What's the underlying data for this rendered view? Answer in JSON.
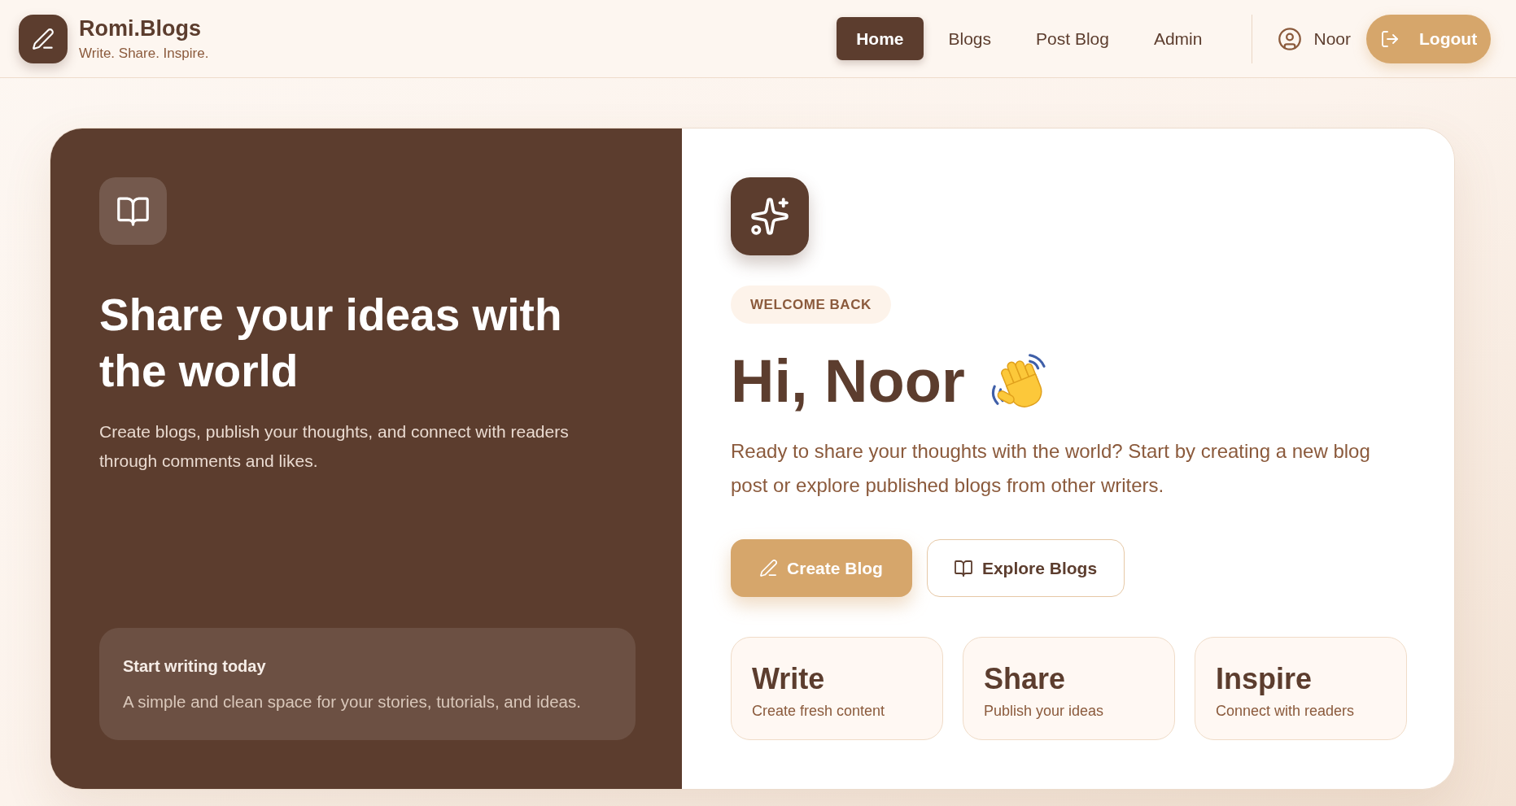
{
  "header": {
    "brand": {
      "name": "Romi.Blogs",
      "tagline": "Write. Share. Inspire."
    },
    "nav": [
      {
        "label": "Home",
        "selected": true
      },
      {
        "label": "Blogs",
        "selected": false
      },
      {
        "label": "Post Blog",
        "selected": false
      },
      {
        "label": "Admin",
        "selected": false
      }
    ],
    "user": {
      "name": "Noor"
    },
    "logout_button": "Logout"
  },
  "hero": {
    "title": "Share your ideas with the world",
    "description": "Create blogs, publish your thoughts, and connect with readers through comments and likes.",
    "callout": {
      "title": "Start writing today",
      "text": "A simple and clean space for your stories, tutorials, and ideas."
    }
  },
  "welcome": {
    "badge": "WELCOME BACK",
    "greeting": "Hi, Noor",
    "description": "Ready to share your thoughts with the world? Start by creating a new blog post or explore published blogs from other writers.",
    "buttons": [
      {
        "label": "Create Blog",
        "kind": "primary"
      },
      {
        "label": "Explore Blogs",
        "kind": "secondary"
      }
    ],
    "features": [
      {
        "title": "Write",
        "subtitle": "Create fresh content"
      },
      {
        "title": "Share",
        "subtitle": "Publish your ideas"
      },
      {
        "title": "Inspire",
        "subtitle": "Connect with readers"
      }
    ]
  }
}
